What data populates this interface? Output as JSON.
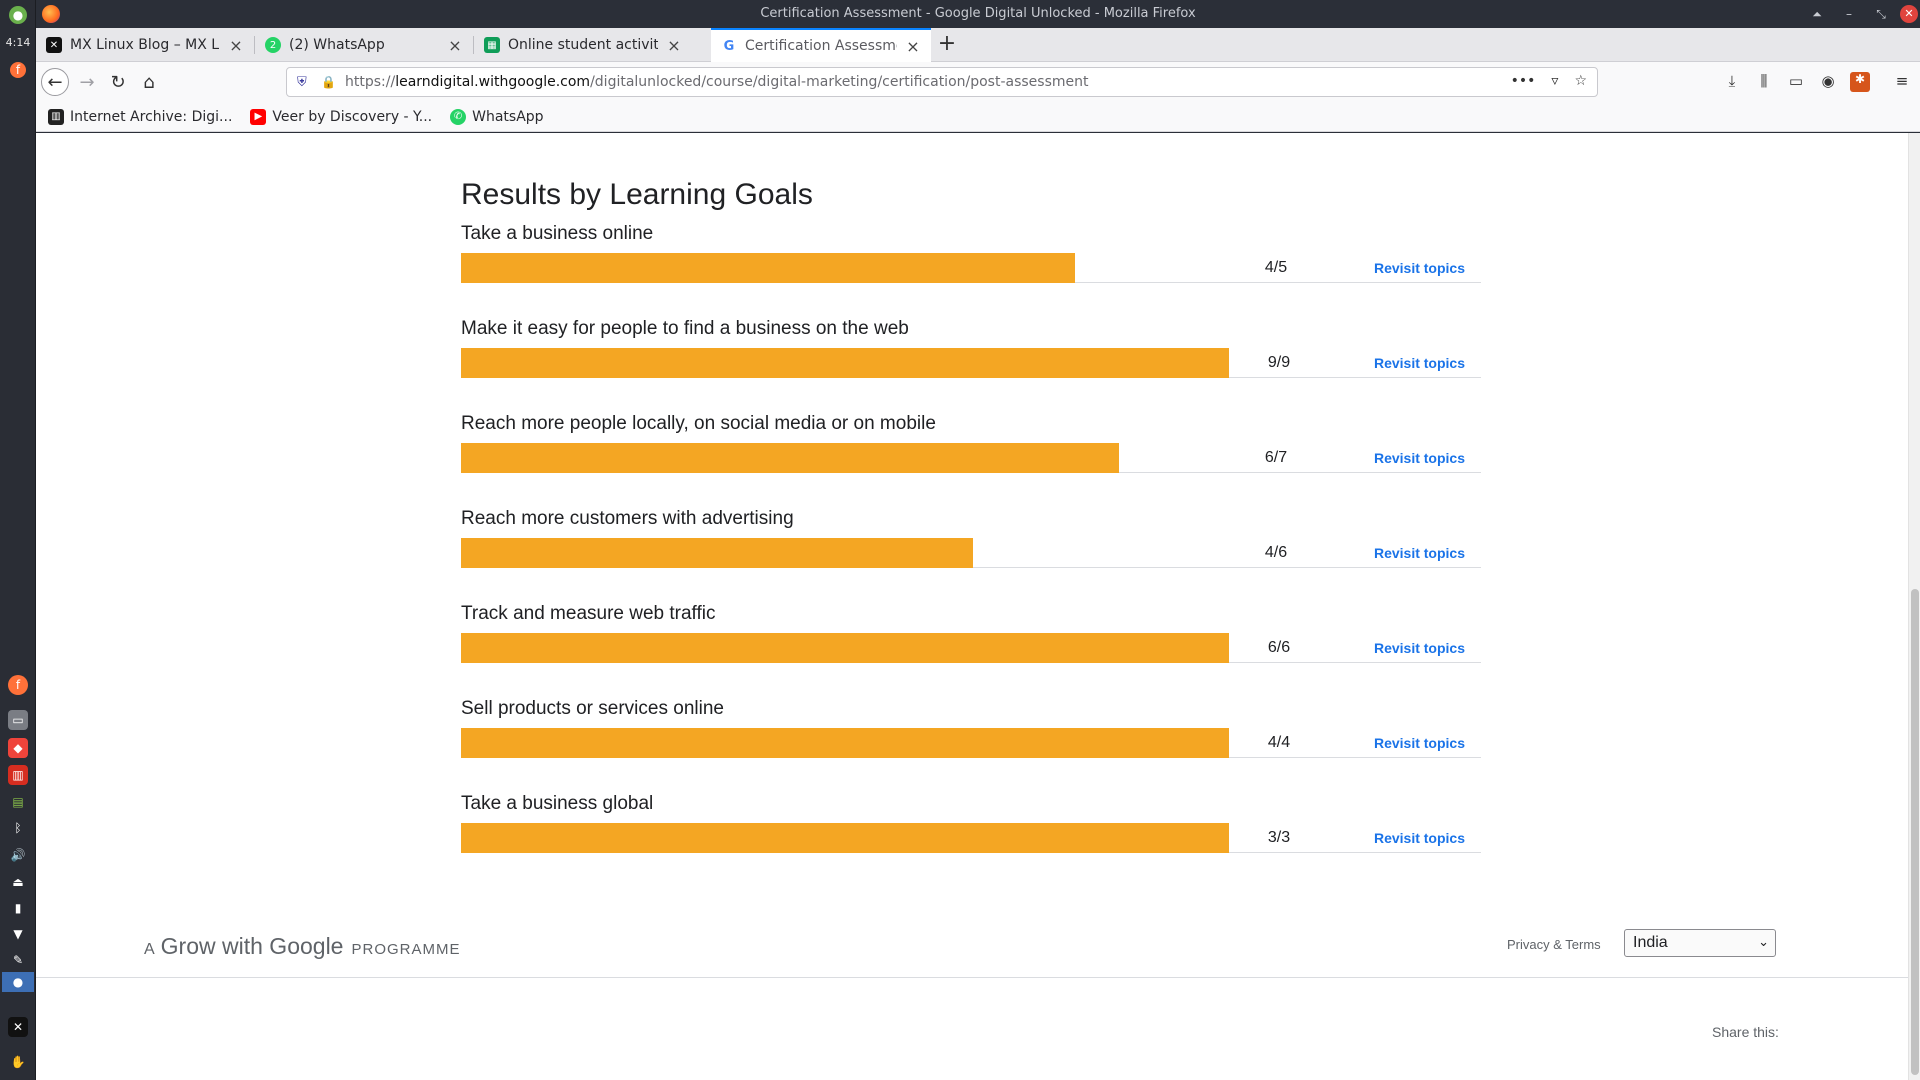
{
  "system": {
    "clock": "4:14"
  },
  "window": {
    "title": "Certification Assessment - Google Digital Unlocked - Mozilla Firefox"
  },
  "tabs": [
    {
      "label": "MX Linux Blog – MX Linu",
      "icon": "x-logo-icon"
    },
    {
      "label": "(2) WhatsApp",
      "icon": "whatsapp-icon",
      "badge": "2"
    },
    {
      "label": "Online student activities",
      "icon": "sheets-icon"
    },
    {
      "label": "Certification Assessment",
      "icon": "google-icon",
      "active": true
    }
  ],
  "urlbar": {
    "url_prefix": "https://",
    "url_domain": "learndigital.withgoogle.com",
    "url_path": "/digitalunlocked/course/digital-marketing/certification/post-assessment"
  },
  "bookmarks": [
    {
      "label": "Internet Archive: Digi...",
      "icon": "archive-icon"
    },
    {
      "label": "Veer by Discovery - Y...",
      "icon": "youtube-icon"
    },
    {
      "label": "WhatsApp",
      "icon": "whatsapp-icon"
    }
  ],
  "section_title": "Results by Learning Goals",
  "goals": [
    {
      "name": "Take a business online",
      "score": "4/5",
      "fraction": 0.8,
      "link": "Revisit topics"
    },
    {
      "name": "Make it easy for people to find a business on the web",
      "score": "9/9",
      "fraction": 1.0,
      "link": "Revisit topics"
    },
    {
      "name": "Reach more people locally, on social media or on mobile",
      "score": "6/7",
      "fraction": 0.857,
      "link": "Revisit topics"
    },
    {
      "name": "Reach more customers with advertising",
      "score": "4/6",
      "fraction": 0.667,
      "link": "Revisit topics"
    },
    {
      "name": "Track and measure web traffic",
      "score": "6/6",
      "fraction": 1.0,
      "link": "Revisit topics"
    },
    {
      "name": "Sell products or services online",
      "score": "4/4",
      "fraction": 1.0,
      "link": "Revisit topics"
    },
    {
      "name": "Take a business global",
      "score": "3/3",
      "fraction": 1.0,
      "link": "Revisit topics"
    }
  ],
  "footer": {
    "grow_a": "A",
    "grow_brand": "Grow with Google",
    "grow_programme": "PROGRAMME",
    "privacy": "Privacy & Terms",
    "country": "India",
    "share": "Share this:"
  },
  "colors": {
    "bar": "#f4a623",
    "link": "#1a73e8"
  }
}
